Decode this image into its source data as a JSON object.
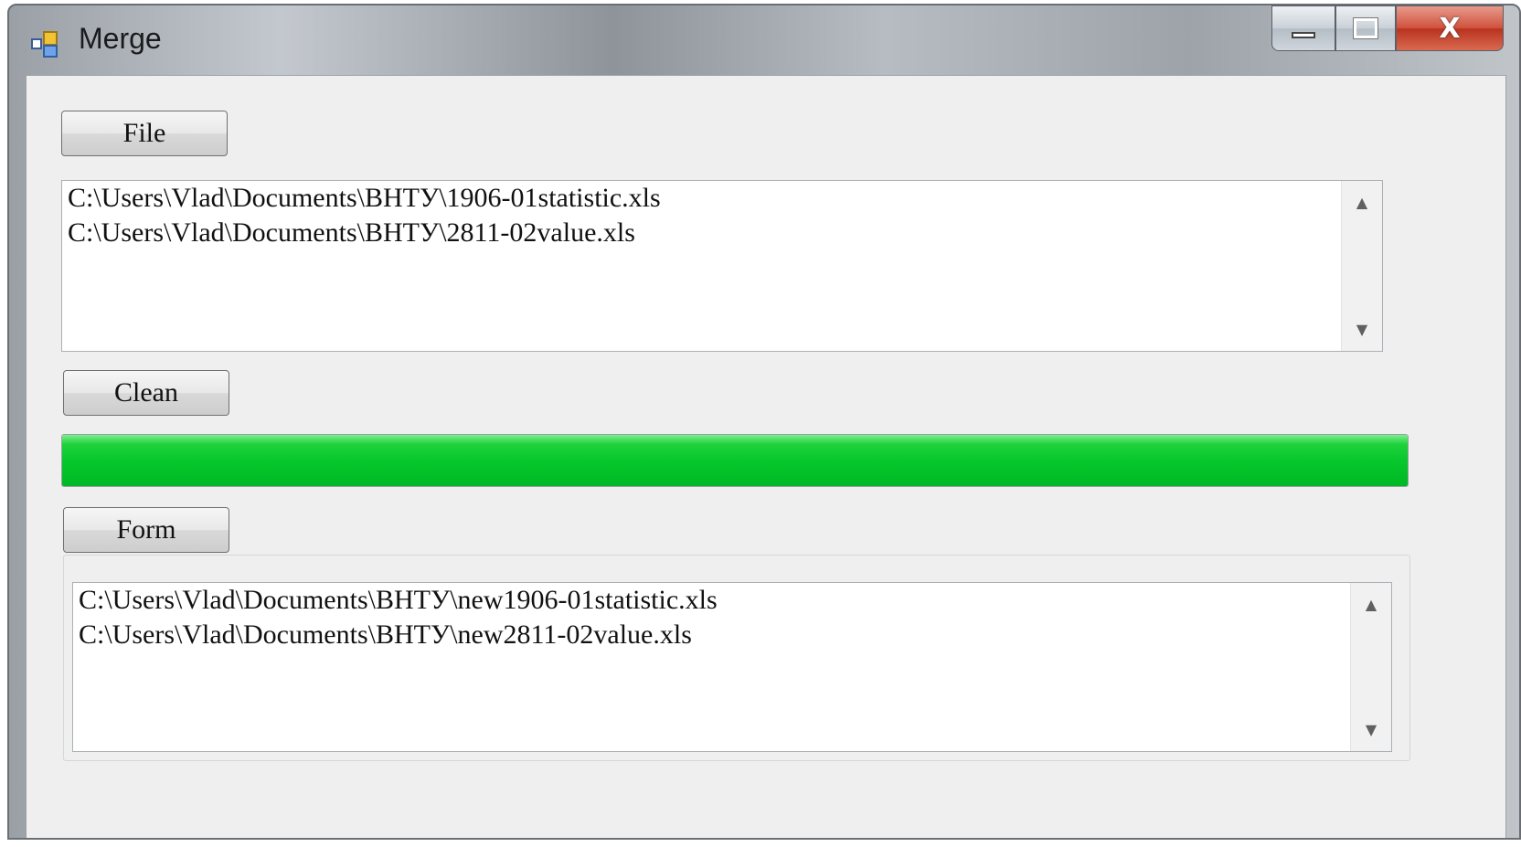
{
  "window": {
    "title": "Merge",
    "controls": {
      "minimize": "minimize",
      "maximize": "maximize",
      "close": "close"
    }
  },
  "buttons": {
    "file": "File",
    "clean": "Clean",
    "form": "Form"
  },
  "input_list": {
    "items": [
      "C:\\Users\\Vlad\\Documents\\ВНТУ\\1906-01statistic.xls",
      "C:\\Users\\Vlad\\Documents\\ВНТУ\\2811-02value.xls"
    ]
  },
  "progress": {
    "value": 100,
    "color": "#00c82a"
  },
  "output_list": {
    "items": [
      "C:\\Users\\Vlad\\Documents\\ВНТУ\\new1906-01statistic.xls",
      "C:\\Users\\Vlad\\Documents\\ВНТУ\\new2811-02value.xls"
    ]
  }
}
